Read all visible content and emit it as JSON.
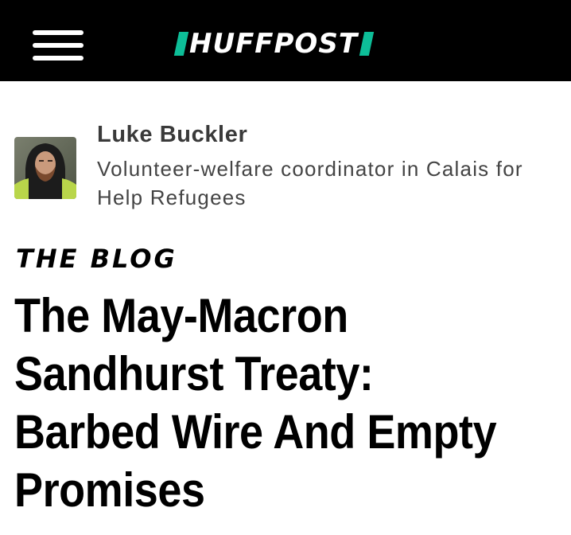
{
  "header": {
    "menu_icon": "hamburger-menu-icon",
    "brand": {
      "name": "HUFFPOST",
      "accent_color": "#0dbe98",
      "background_color": "#000000"
    }
  },
  "author": {
    "name": "Luke Buckler",
    "bio": "Volunteer-welfare coordinator in Calais for Help Refugees",
    "avatar_icon": "author-avatar"
  },
  "article": {
    "section_label": "THE BLOG",
    "title": "The May-Macron Sandhurst Treaty: Barbed Wire And Empty Promises"
  }
}
